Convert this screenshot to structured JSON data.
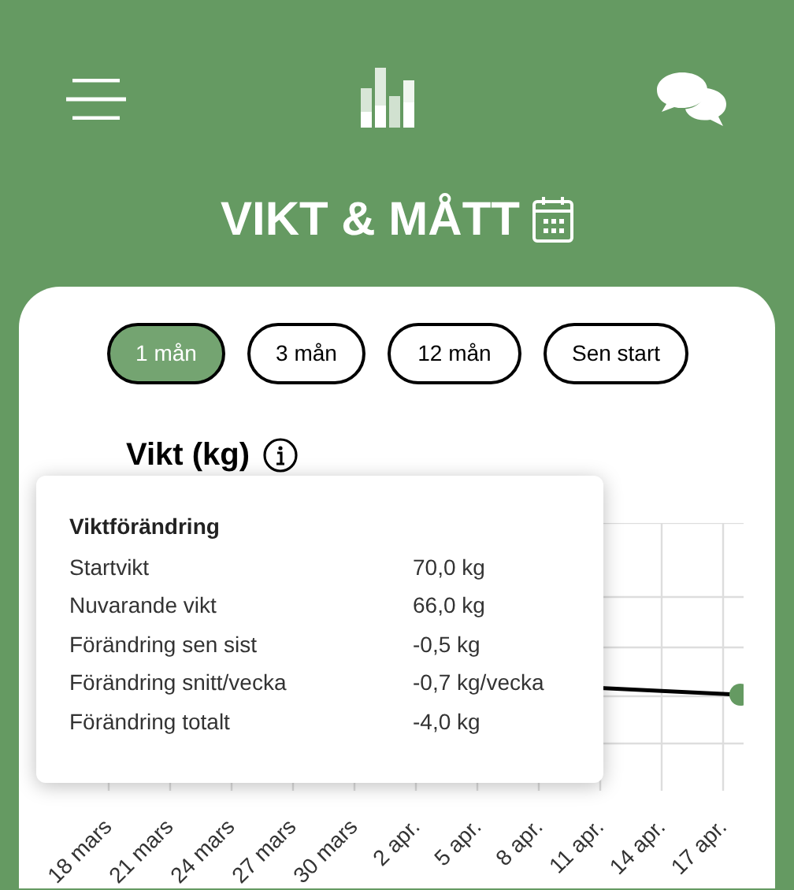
{
  "page_title": "VIKT & MÅTT",
  "periods": [
    {
      "label": "1 mån",
      "selected": true
    },
    {
      "label": "3 mån",
      "selected": false
    },
    {
      "label": "12 mån",
      "selected": false
    },
    {
      "label": "Sen start",
      "selected": false
    }
  ],
  "chart": {
    "title": "Vikt (kg)",
    "x_labels": [
      "18 mars",
      "21 mars",
      "24 mars",
      "27 mars",
      "30 mars",
      "2 apr.",
      "5 apr.",
      "8 apr.",
      "11 apr.",
      "14 apr.",
      "17 apr."
    ]
  },
  "tooltip": {
    "title": "Viktförändring",
    "rows": [
      {
        "label": "Startvikt",
        "value": "70,0 kg"
      },
      {
        "label": "Nuvarande vikt",
        "value": "66,0 kg"
      },
      {
        "label": "Förändring sen sist",
        "value": "-0,5 kg"
      },
      {
        "label": "Förändring snitt/vecka",
        "value": "-0,7 kg/vecka"
      },
      {
        "label": "Förändring totalt",
        "value": "-4,0 kg"
      }
    ]
  }
}
